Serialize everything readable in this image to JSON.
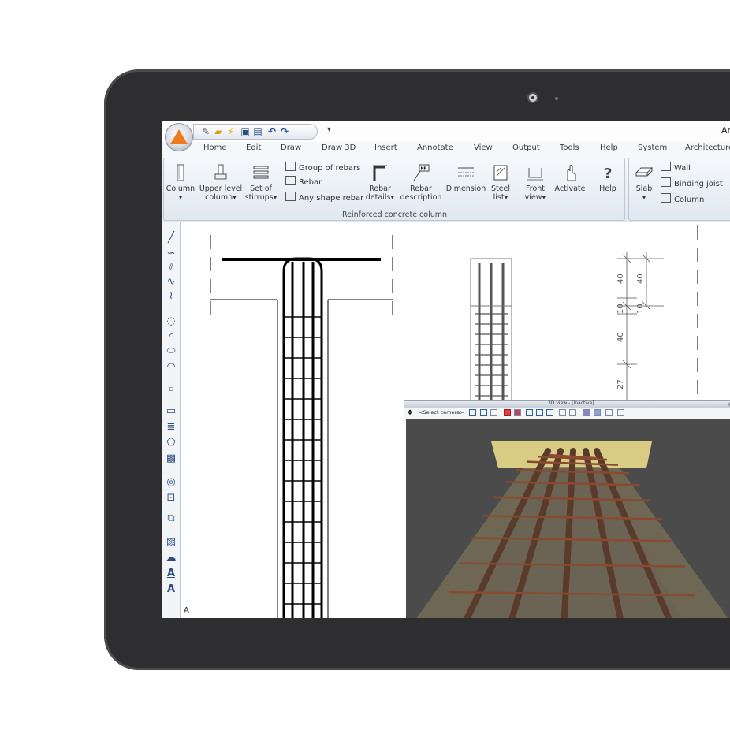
{
  "app": {
    "title": "Ar"
  },
  "quick_access": {
    "more_label": "▾"
  },
  "tabs": [
    "Home",
    "Edit",
    "Draw",
    "Draw 3D",
    "Insert",
    "Annotate",
    "View",
    "Output",
    "Tools",
    "Help",
    "System",
    "Architecture"
  ],
  "ribbon": {
    "column": {
      "line1": "Column",
      "line2": "▾"
    },
    "upper_level_column": {
      "line1": "Upper level",
      "line2": "column▾"
    },
    "set_of_stirrups": {
      "line1": "Set of",
      "line2": "stirrups▾"
    },
    "group_of_rebars": "Group of rebars",
    "rebar": "Rebar",
    "any_shape_rebar": "Any shape rebar",
    "rebar_details": {
      "line1": "Rebar",
      "line2": "details▾"
    },
    "rebar_description": {
      "line1": "Rebar",
      "line2": "description"
    },
    "dimension": {
      "line1": "Dimension",
      "line2": ""
    },
    "steel_list": {
      "line1": "Steel",
      "line2": "list▾"
    },
    "front_view": {
      "line1": "Front",
      "line2": "view▾"
    },
    "activate": {
      "line1": "Activate",
      "line2": ""
    },
    "help": {
      "line1": "Help",
      "line2": ""
    },
    "group_label": "Reinforced concrete column",
    "slab": {
      "line1": "Slab",
      "line2": "▾"
    },
    "wall": "Wall",
    "binding_joist": "Binding joist",
    "column_small": "Column"
  },
  "drawing": {
    "dimensions": [
      "40",
      "40",
      "10",
      "10",
      "40",
      "27"
    ],
    "axis_label": "A",
    "rebar_tag": "NR"
  },
  "window_3d": {
    "title": "3D view - [Inactive]",
    "camera_select": "<Select camera>"
  },
  "colors": {
    "accent": "#f07b1e",
    "bezel": "#2e2e30",
    "rebar": "#5a3a2a",
    "concrete_slab": "#e9dc8c",
    "scene_bg": "#4b4b4b"
  }
}
